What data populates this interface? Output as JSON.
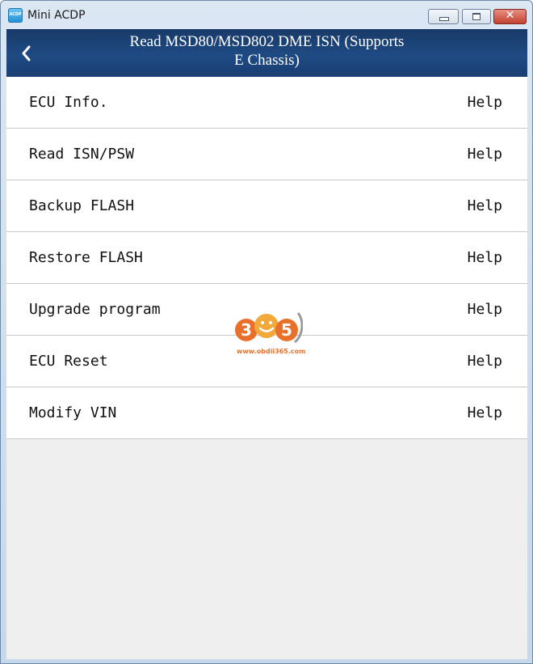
{
  "window": {
    "app_title": "Mini ACDP",
    "icon_text": "ACDP"
  },
  "header": {
    "title_line1": "Read MSD80/MSD802 DME ISN (Supports",
    "title_line2": "E Chassis)"
  },
  "menu": {
    "items": [
      {
        "label": "ECU Info.",
        "help": "Help"
      },
      {
        "label": "Read ISN/PSW",
        "help": "Help"
      },
      {
        "label": "Backup FLASH",
        "help": "Help"
      },
      {
        "label": "Restore FLASH",
        "help": "Help"
      },
      {
        "label": "Upgrade program",
        "help": "Help"
      },
      {
        "label": "ECU Reset",
        "help": "Help"
      },
      {
        "label": "Modify VIN",
        "help": "Help"
      }
    ]
  },
  "watermark": {
    "logo_text": "365",
    "url": "www.obdii365.com"
  },
  "colors": {
    "header_bg": "#1e4a83",
    "list_bg": "#ffffff",
    "content_bg": "#efefef",
    "close_button": "#c3412f",
    "watermark": "#e8702a"
  }
}
